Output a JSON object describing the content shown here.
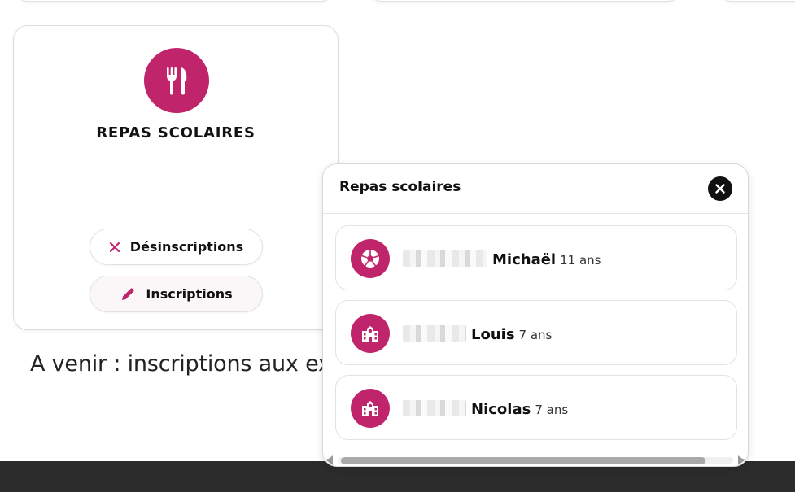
{
  "service_card": {
    "title": "REPAS SCOLAIRES",
    "icon": "fork-knife-icon",
    "unsubscribe_label": "Désinscriptions",
    "subscribe_label": "Inscriptions"
  },
  "announcement": "A venir : inscriptions aux ex                                                     ves/c",
  "popup": {
    "title": "Repas scolaires",
    "close_icon": "close-icon",
    "children": [
      {
        "first_name": "Michaël",
        "age": "11 ans",
        "icon": "soccer-ball-icon"
      },
      {
        "first_name": "Louis",
        "age": "7 ans",
        "icon": "school-building-icon"
      },
      {
        "first_name": "Nicolas",
        "age": "7 ans",
        "icon": "school-building-icon"
      }
    ]
  },
  "colors": {
    "accent": "#c0246a",
    "footer": "#2c2c2c"
  }
}
